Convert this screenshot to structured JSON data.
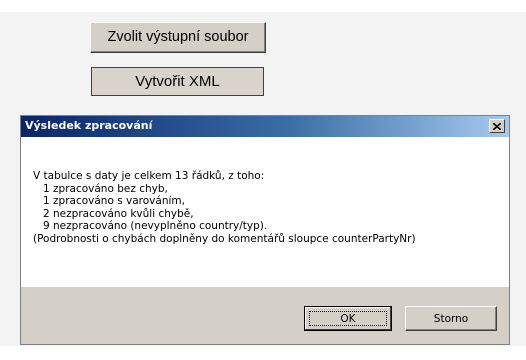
{
  "form": {
    "output_button_label": "Zvolit výstupní soubor",
    "xml_button_label": "Vytvořit XML"
  },
  "dialog": {
    "title": "Výsledek zpracování",
    "close_icon": "close-icon",
    "message_lines": [
      "V tabulce s daty je celkem 13 řádků, z toho:",
      "   1 zpracováno bez chyb,",
      "   1 zpracováno s varováním,",
      "   2 nezpracováno kvůli chybě,",
      "   9 nezpracováno (nevyplněno country/typ).",
      "(Podrobnosti o chybách doplněny do komentářů sloupce counterPartyNr)"
    ],
    "ok_label": "OK",
    "cancel_label": "Storno"
  },
  "colors": {
    "titlebar_start": "#0a246a",
    "titlebar_end": "#a6caf0",
    "button_face": "#d4d0c8"
  }
}
